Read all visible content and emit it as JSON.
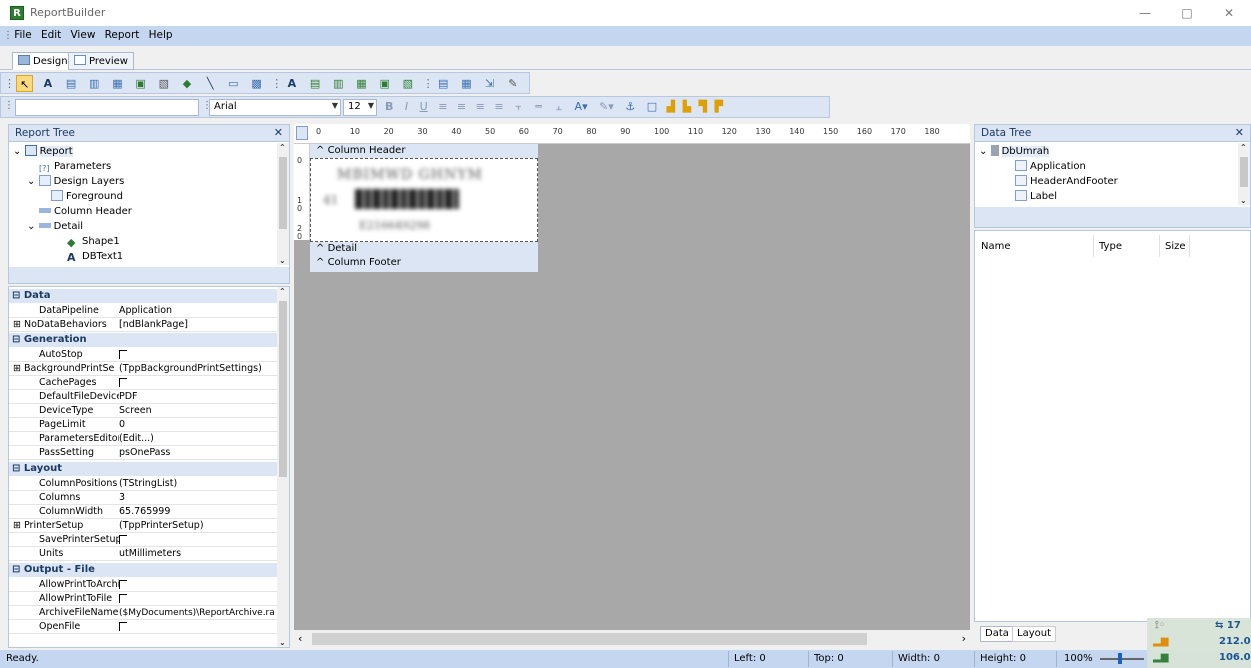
{
  "window": {
    "title": "ReportBuilder",
    "app_icon": "R",
    "minimize": "—",
    "maximize": "□",
    "close": "✕"
  },
  "menu": [
    "File",
    "Edit",
    "View",
    "Report",
    "Help"
  ],
  "view_tabs": [
    {
      "label": "Design"
    },
    {
      "label": "Preview"
    }
  ],
  "format": {
    "font_name": "Arial",
    "font_size": "12"
  },
  "report_tree": {
    "title": "Report Tree",
    "items": [
      "Report",
      "Parameters",
      "Design Layers",
      "Foreground",
      "Column Header",
      "Detail",
      "Shape1",
      "DBText1"
    ]
  },
  "inspector": {
    "categories": {
      "data": "Data",
      "generation": "Generation",
      "layout": "Layout",
      "output_file": "Output - File"
    },
    "props": {
      "datapipeline": {
        "name": "DataPipeline",
        "value": "Application"
      },
      "nodatabehaviors": {
        "name": "NoDataBehaviors",
        "value": "[ndBlankPage]"
      },
      "autostop": {
        "name": "AutoStop"
      },
      "backgroundprint": {
        "name": "BackgroundPrintSe",
        "value": "(TppBackgroundPrintSettings)"
      },
      "cachepages": {
        "name": "CachePages"
      },
      "defaultfiledevice": {
        "name": "DefaultFileDeviceT",
        "value": "PDF"
      },
      "devicetype": {
        "name": "DeviceType",
        "value": "Screen"
      },
      "pagelimit": {
        "name": "PageLimit",
        "value": "0"
      },
      "parameterseditor": {
        "name": "ParametersEditor",
        "value": "(Edit...)"
      },
      "passsetting": {
        "name": "PassSetting",
        "value": "psOnePass"
      },
      "columnpositions": {
        "name": "ColumnPositions",
        "value": "(TStringList)"
      },
      "columns": {
        "name": "Columns",
        "value": "3"
      },
      "columnwidth": {
        "name": "ColumnWidth",
        "value": "65.765999"
      },
      "printersetup": {
        "name": "PrinterSetup",
        "value": "(TppPrinterSetup)"
      },
      "saveprintersetup": {
        "name": "SavePrinterSetup"
      },
      "units": {
        "name": "Units",
        "value": "utMillimeters"
      },
      "allowprinttoarchive": {
        "name": "AllowPrintToArchiv"
      },
      "allowprinttofile": {
        "name": "AllowPrintToFile"
      },
      "archivefilename": {
        "name": "ArchiveFileName",
        "value": "($MyDocuments)\\ReportArchive.ra"
      },
      "openfile": {
        "name": "OpenFile"
      }
    }
  },
  "design": {
    "ruler_marks": [
      "0",
      "10",
      "20",
      "30",
      "40",
      "50",
      "60",
      "70",
      "80",
      "90",
      "100",
      "110",
      "120",
      "130",
      "140",
      "150",
      "160",
      "170",
      "180"
    ],
    "left_ruler": [
      "0",
      "1",
      "0",
      "2",
      "0"
    ],
    "bands": {
      "column_header": "Column Header",
      "detail": "Detail",
      "column_footer": "Column Footer"
    }
  },
  "data_tree": {
    "title": "Data Tree",
    "root": "DbUmrah",
    "items": [
      "Application",
      "HeaderAndFooter",
      "Label"
    ],
    "columns": {
      "name": "Name",
      "type": "Type",
      "size": "Size"
    },
    "tabs": {
      "data": "Data",
      "layout": "Layout"
    }
  },
  "status": {
    "text": "Ready.",
    "left": "Left: 0",
    "top": "Top: 0",
    "width": "Width: 0",
    "height": "Height: 0",
    "zoom": "100%"
  },
  "tray": {
    "a": "17",
    "b": "212.0",
    "c": "106.0"
  }
}
